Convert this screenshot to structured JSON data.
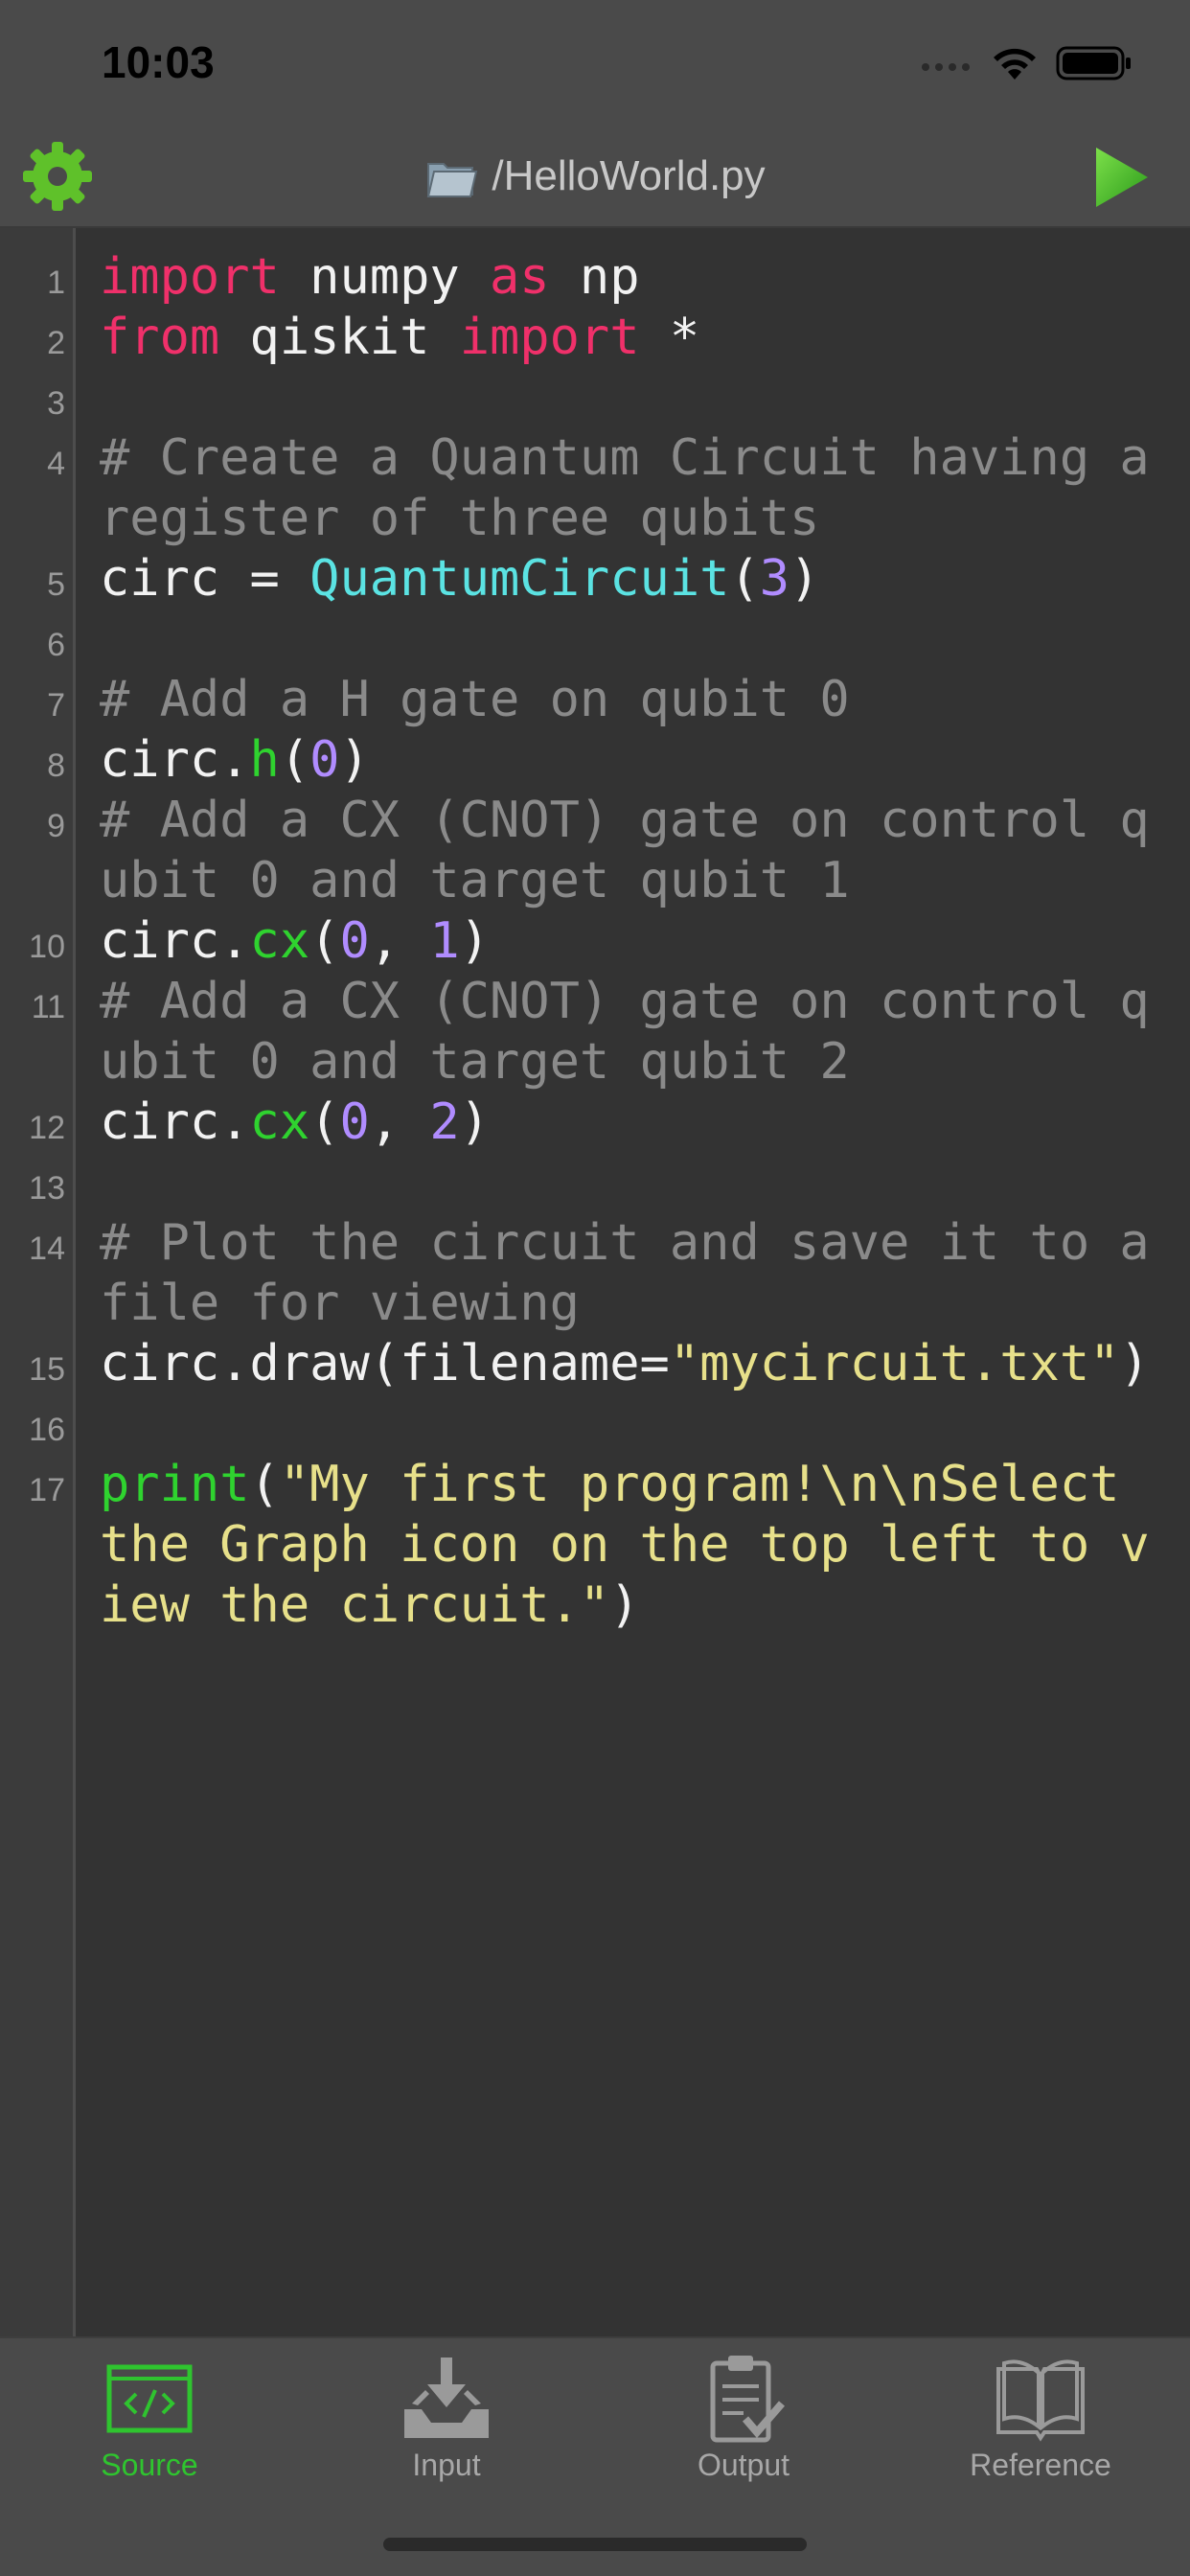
{
  "status_bar": {
    "time": "10:03"
  },
  "nav": {
    "title": "/HelloWorld.py"
  },
  "code_lines": [
    {
      "n": "1",
      "tokens": [
        {
          "t": "import",
          "c": "kw"
        },
        {
          "t": " numpy ",
          "c": ""
        },
        {
          "t": "as",
          "c": "kw"
        },
        {
          "t": " np",
          "c": ""
        }
      ]
    },
    {
      "n": "2",
      "tokens": [
        {
          "t": "from",
          "c": "kw"
        },
        {
          "t": " qiskit ",
          "c": ""
        },
        {
          "t": "import",
          "c": "kw"
        },
        {
          "t": " *",
          "c": ""
        }
      ]
    },
    {
      "n": "3",
      "tokens": []
    },
    {
      "n": "4",
      "tokens": [
        {
          "t": "# Create a Quantum Circuit having a register of three qubits",
          "c": "cm"
        }
      ]
    },
    {
      "n": "5",
      "tokens": [
        {
          "t": "circ = ",
          "c": ""
        },
        {
          "t": "QuantumCircuit",
          "c": "cls"
        },
        {
          "t": "(",
          "c": ""
        },
        {
          "t": "3",
          "c": "num"
        },
        {
          "t": ")",
          "c": ""
        }
      ]
    },
    {
      "n": "6",
      "tokens": []
    },
    {
      "n": "7",
      "tokens": [
        {
          "t": "# Add a H gate on qubit 0",
          "c": "cm"
        }
      ]
    },
    {
      "n": "8",
      "tokens": [
        {
          "t": "circ.",
          "c": ""
        },
        {
          "t": "h",
          "c": "fn"
        },
        {
          "t": "(",
          "c": ""
        },
        {
          "t": "0",
          "c": "num"
        },
        {
          "t": ")",
          "c": ""
        }
      ]
    },
    {
      "n": "9",
      "tokens": [
        {
          "t": "# Add a CX (CNOT) gate on control qubit 0 and target qubit 1",
          "c": "cm"
        }
      ]
    },
    {
      "n": "10",
      "tokens": [
        {
          "t": "circ.",
          "c": ""
        },
        {
          "t": "cx",
          "c": "fn"
        },
        {
          "t": "(",
          "c": ""
        },
        {
          "t": "0",
          "c": "num"
        },
        {
          "t": ", ",
          "c": ""
        },
        {
          "t": "1",
          "c": "num"
        },
        {
          "t": ")",
          "c": ""
        }
      ]
    },
    {
      "n": "11",
      "tokens": [
        {
          "t": "# Add a CX (CNOT) gate on control qubit 0 and target qubit 2",
          "c": "cm"
        }
      ]
    },
    {
      "n": "12",
      "tokens": [
        {
          "t": "circ.",
          "c": ""
        },
        {
          "t": "cx",
          "c": "fn"
        },
        {
          "t": "(",
          "c": ""
        },
        {
          "t": "0",
          "c": "num"
        },
        {
          "t": ", ",
          "c": ""
        },
        {
          "t": "2",
          "c": "num"
        },
        {
          "t": ")",
          "c": ""
        }
      ]
    },
    {
      "n": "13",
      "tokens": []
    },
    {
      "n": "14",
      "tokens": [
        {
          "t": "# Plot the circuit and save it to a file for viewing",
          "c": "cm"
        }
      ]
    },
    {
      "n": "15",
      "tokens": [
        {
          "t": "circ.draw(filename=",
          "c": ""
        },
        {
          "t": "\"mycircuit.txt\"",
          "c": "str"
        },
        {
          "t": ")",
          "c": ""
        }
      ]
    },
    {
      "n": "16",
      "tokens": []
    },
    {
      "n": "17",
      "tokens": [
        {
          "t": "print",
          "c": "fn"
        },
        {
          "t": "(",
          "c": ""
        },
        {
          "t": "\"My first program!\\n\\nSelect the Graph icon on the top left to view the circuit.\"",
          "c": "str"
        },
        {
          "t": ")",
          "c": ""
        }
      ]
    }
  ],
  "tabs": [
    {
      "id": "source",
      "label": "Source",
      "icon": "code-icon",
      "active": true
    },
    {
      "id": "input",
      "label": "Input",
      "icon": "download-tray-icon",
      "active": false
    },
    {
      "id": "output",
      "label": "Output",
      "icon": "clipboard-check-icon",
      "active": false
    },
    {
      "id": "reference",
      "label": "Reference",
      "icon": "book-icon",
      "active": false
    }
  ],
  "colors": {
    "accent_green": "#2fc42f",
    "inactive_tab": "#a8a8a8",
    "keyword": "#f0306a",
    "comment": "#8a8a8a",
    "function": "#2fd32f",
    "class": "#5be3e3",
    "number": "#b08cff",
    "string": "#e7e08a"
  }
}
